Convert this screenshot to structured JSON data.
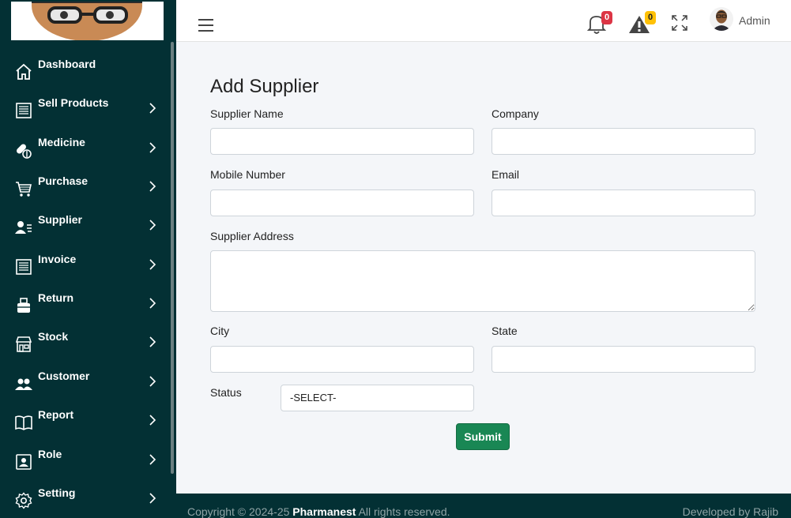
{
  "header": {
    "notifications_count": "0",
    "alerts_count": "0",
    "user_name": "Admin"
  },
  "sidebar": {
    "items": [
      {
        "label": "Dashboard",
        "icon": "home-icon"
      },
      {
        "label": "Sell Products",
        "icon": "receipt-icon"
      },
      {
        "label": "Medicine",
        "icon": "pills-icon"
      },
      {
        "label": "Purchase",
        "icon": "cart-icon"
      },
      {
        "label": "Supplier",
        "icon": "user-list-icon"
      },
      {
        "label": "Invoice",
        "icon": "invoice-icon"
      },
      {
        "label": "Return",
        "icon": "return-box-icon"
      },
      {
        "label": "Stock",
        "icon": "store-icon"
      },
      {
        "label": "Customer",
        "icon": "users-icon"
      },
      {
        "label": "Report",
        "icon": "book-icon"
      },
      {
        "label": "Role",
        "icon": "id-badge-icon"
      },
      {
        "label": "Setting",
        "icon": "gear-icon"
      }
    ]
  },
  "form": {
    "title": "Add Supplier",
    "supplier_name_label": "Supplier Name",
    "company_label": "Company",
    "mobile_label": "Mobile Number",
    "email_label": "Email",
    "address_label": "Supplier Address",
    "city_label": "City",
    "state_label": "State",
    "status_label": "Status",
    "status_value": "-SELECT-",
    "submit_label": "Submit"
  },
  "footer": {
    "copyright_prefix": "Copyright © 2024-25",
    "brand": "Pharmanest",
    "rights": "All rights reserved.",
    "developer": "Developed by Rajib"
  },
  "colors": {
    "sidebar_bg": "#033034",
    "submit_green": "#198754",
    "badge_red": "#dc3545",
    "badge_yellow": "#ffc107"
  }
}
